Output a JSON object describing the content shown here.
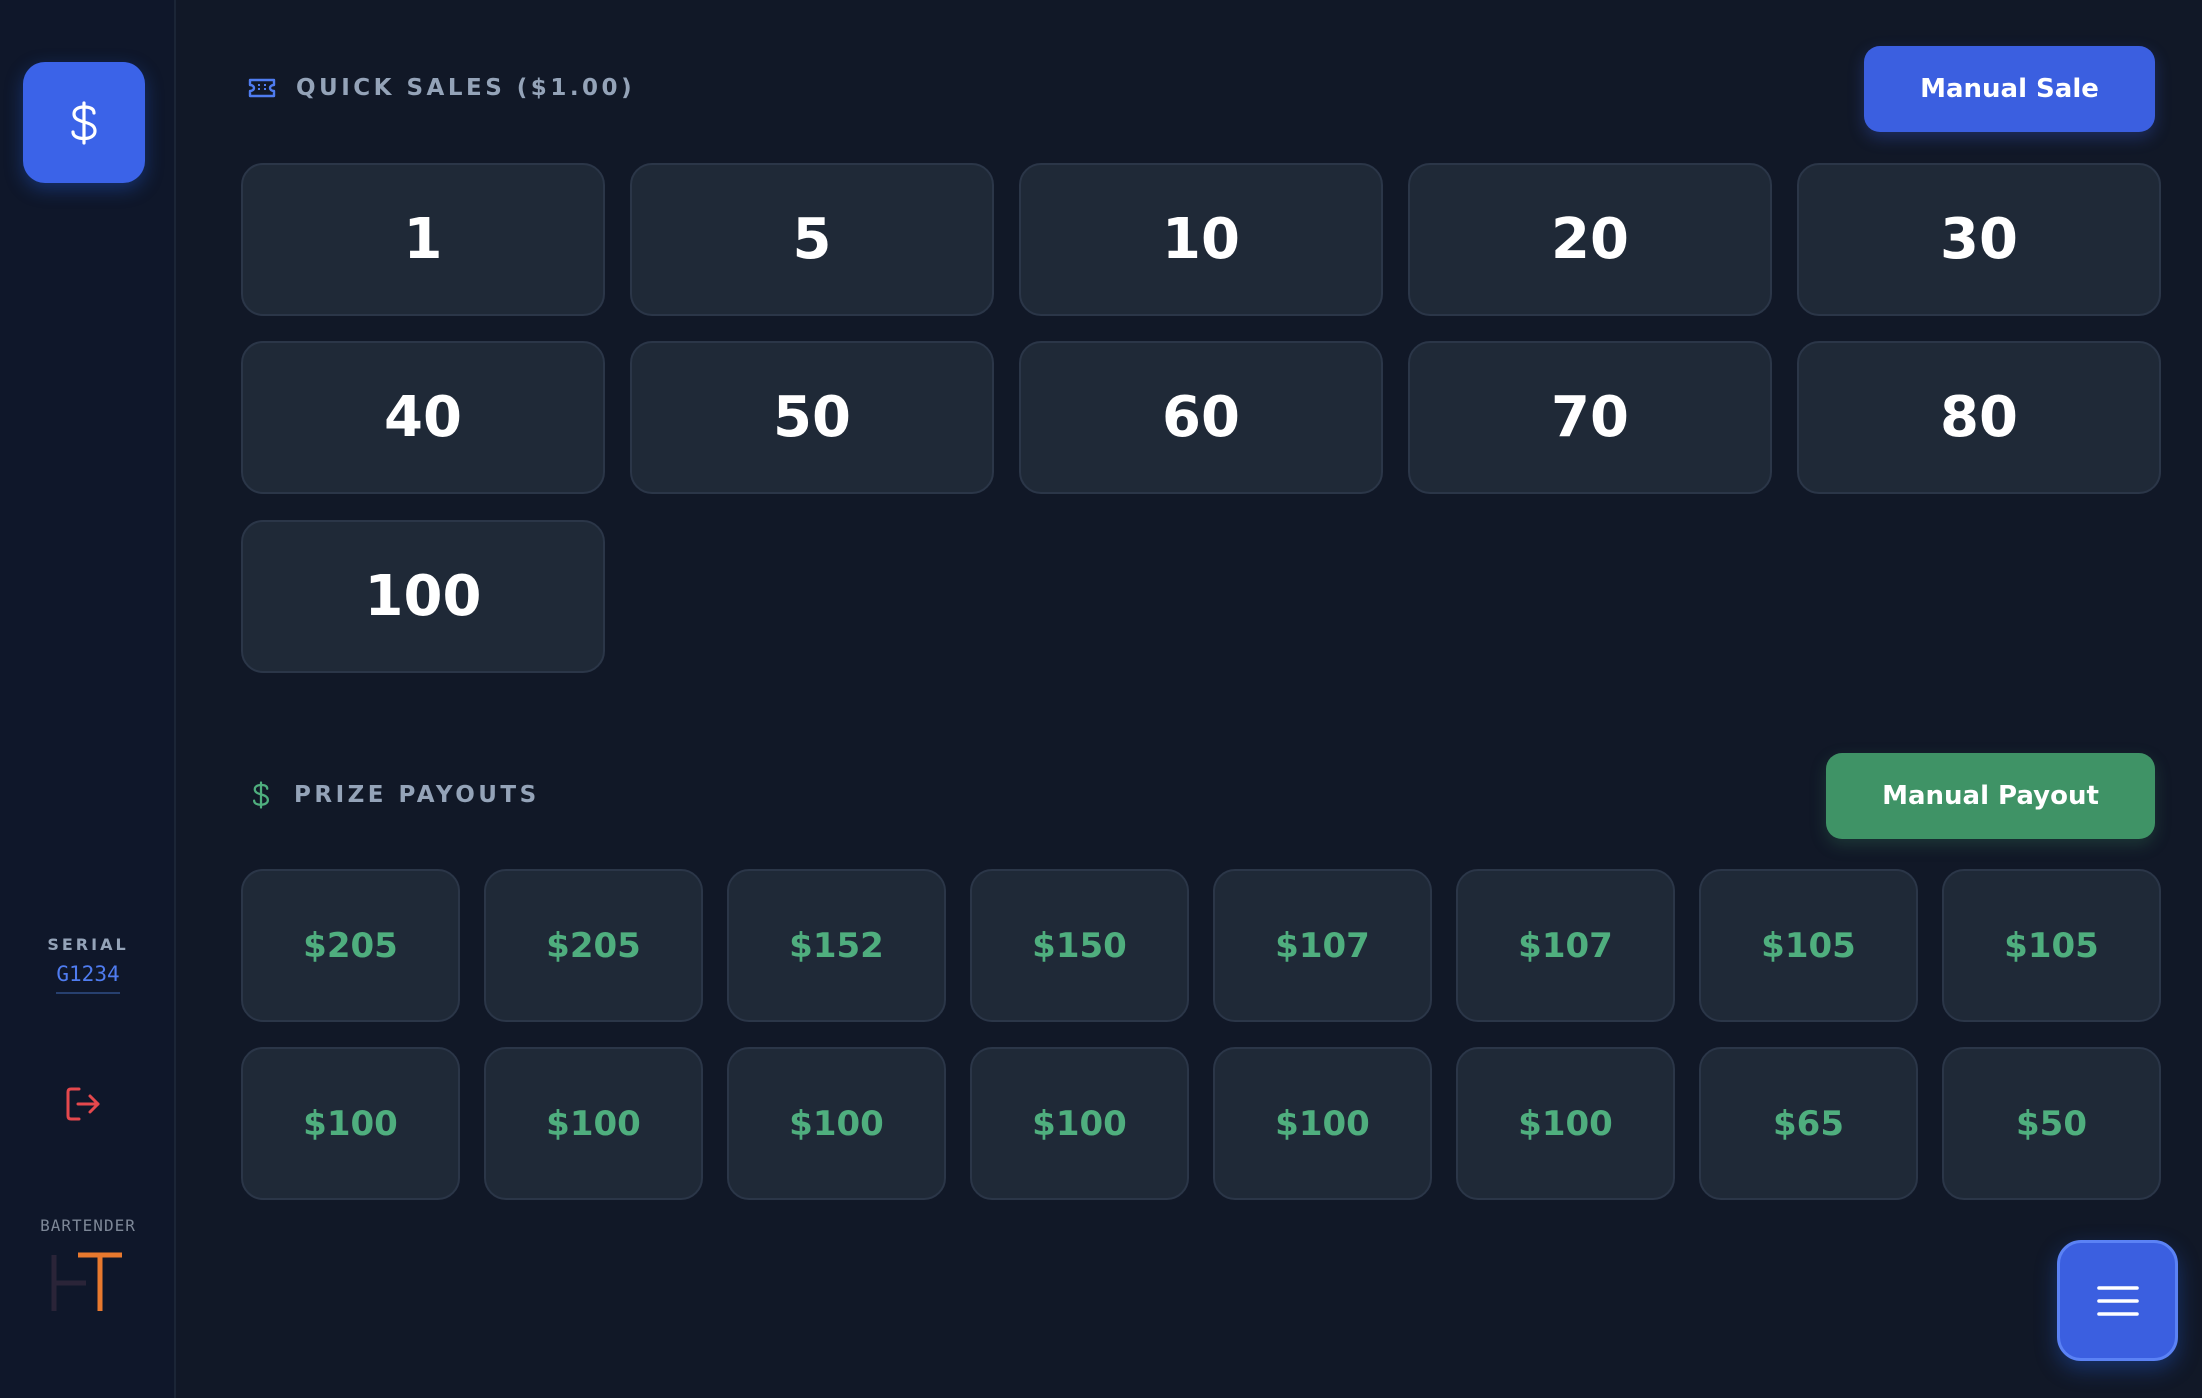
{
  "sidebar": {
    "serial_label": "SERIAL",
    "serial_value": "G1234",
    "brand_label": "BARTENDER"
  },
  "quick_sales": {
    "title": "QUICK SALES ($1.00)",
    "manual_label": "Manual Sale",
    "amounts": [
      "1",
      "5",
      "10",
      "20",
      "30",
      "40",
      "50",
      "60",
      "70",
      "80",
      "100"
    ]
  },
  "prize_payouts": {
    "title": "PRIZE PAYOUTS",
    "manual_label": "Manual Payout",
    "amounts": [
      "$205",
      "$205",
      "$152",
      "$150",
      "$107",
      "$107",
      "$105",
      "$105",
      "$100",
      "$100",
      "$100",
      "$100",
      "$100",
      "$100",
      "$65",
      "$50"
    ]
  },
  "icons": {
    "sales_nav": "dollar-icon",
    "quick_sales": "ticket-icon",
    "prize_payouts": "dollar-icon",
    "logout": "logout-icon",
    "menu": "menu-icon"
  },
  "colors": {
    "background": "#111827",
    "primary": "#3b5fe0",
    "success": "#3f9366",
    "payout_text": "#4fae7e",
    "logout": "#e5484d",
    "brand_orange": "#e8792e"
  }
}
